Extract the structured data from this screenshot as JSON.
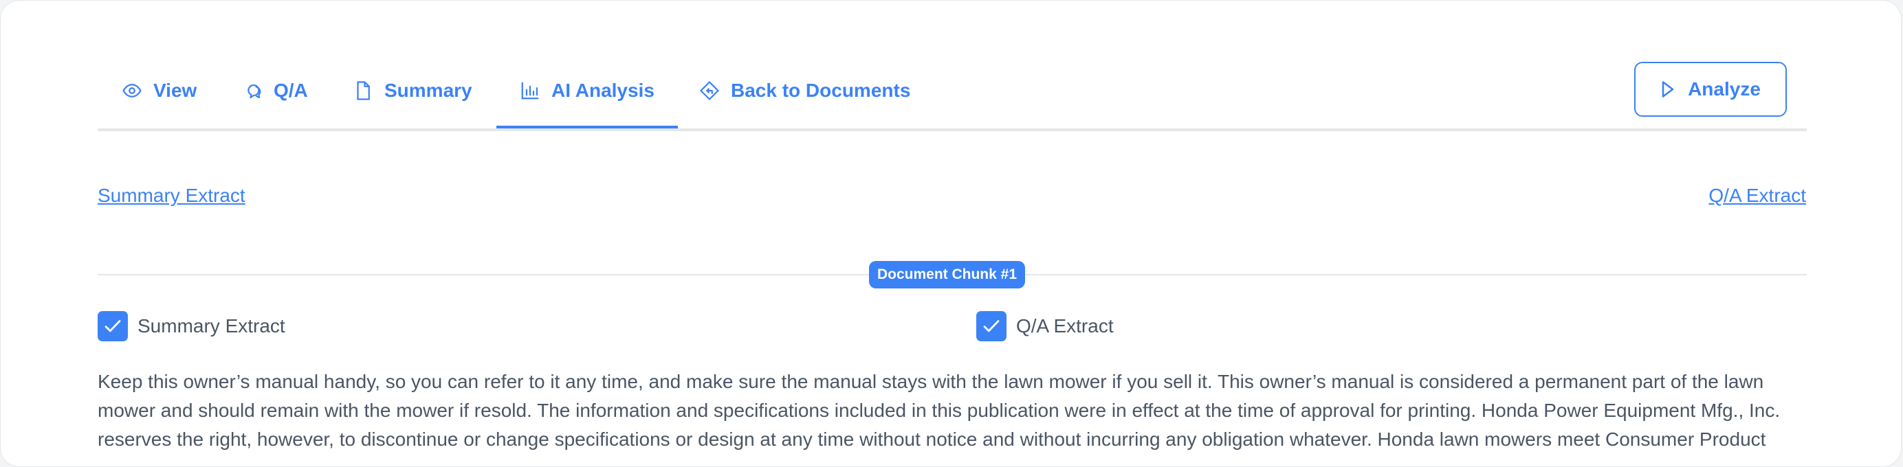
{
  "tabs": [
    {
      "label": "View",
      "icon": "eye-icon"
    },
    {
      "label": "Q/A",
      "icon": "chat-bubbles-icon"
    },
    {
      "label": "Summary",
      "icon": "document-icon"
    },
    {
      "label": "AI Analysis",
      "icon": "bar-chart-icon",
      "active": true
    },
    {
      "label": "Back to Documents",
      "icon": "back-arrow-diamond-icon"
    }
  ],
  "analyze": {
    "label": "Analyze",
    "icon": "play-icon"
  },
  "links": {
    "left": "Summary Extract",
    "right": "Q/A Extract"
  },
  "chunk": {
    "label": "Document Chunk #1"
  },
  "checkboxes": {
    "summary": {
      "label": "Summary Extract",
      "checked": true
    },
    "qa": {
      "label": "Q/A Extract",
      "checked": true
    }
  },
  "content": {
    "text": "Keep this owner’s manual handy, so you can refer to it any time, and make sure the manual stays with the lawn mower if you sell it. This owner’s manual is considered a permanent part of the lawn mower and should remain with the mower if resold. The information and specifications included in this publication were in effect at the time of approval for printing. Honda Power Equipment Mfg., Inc. reserves the right, however, to discontinue or change specifications or design at any time without notice and without incurring any obligation whatever. Honda lawn mowers meet Consumer Product"
  },
  "colors": {
    "accent": "#3b82f6",
    "text": "#4b5563",
    "border": "#e5e7eb"
  }
}
